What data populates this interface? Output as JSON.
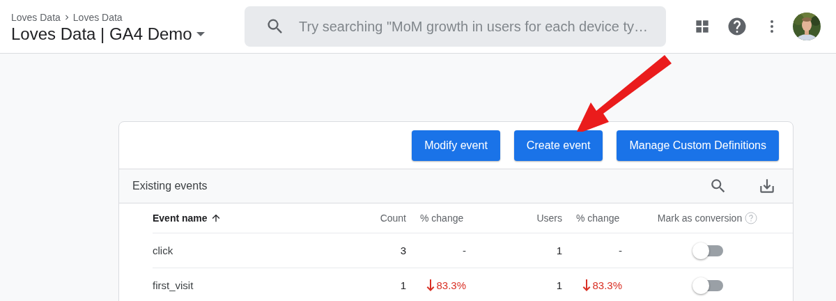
{
  "header": {
    "breadcrumb": [
      "Loves Data",
      "Loves Data"
    ],
    "title": "Loves Data | GA4 Demo",
    "search": {
      "placeholder": "Try searching \"MoM growth in users for each device ty…"
    }
  },
  "actions": [
    "Modify event",
    "Create event",
    "Manage Custom Definitions"
  ],
  "table": {
    "title": "Existing events",
    "columns": [
      {
        "label": "Event name",
        "sorted_ascending": true
      },
      {
        "label": "Count",
        "sorted_ascending": false
      },
      {
        "label": "% change",
        "sorted_ascending": false
      },
      {
        "label": "Users",
        "sorted_ascending": false
      },
      {
        "label": "% change",
        "sorted_ascending": false
      },
      {
        "label": "Mark as conversion",
        "sorted_ascending": false
      }
    ],
    "rows": [
      {
        "name": "click",
        "count": "3",
        "count_change": {
          "text": "-",
          "decrease": false
        },
        "users": "1",
        "users_change": {
          "text": "-",
          "decrease": false
        },
        "conversion": false
      },
      {
        "name": "first_visit",
        "count": "1",
        "count_change": {
          "text": "83.3%",
          "decrease": true
        },
        "users": "1",
        "users_change": {
          "text": "83.3%",
          "decrease": true
        },
        "conversion": false
      }
    ]
  }
}
